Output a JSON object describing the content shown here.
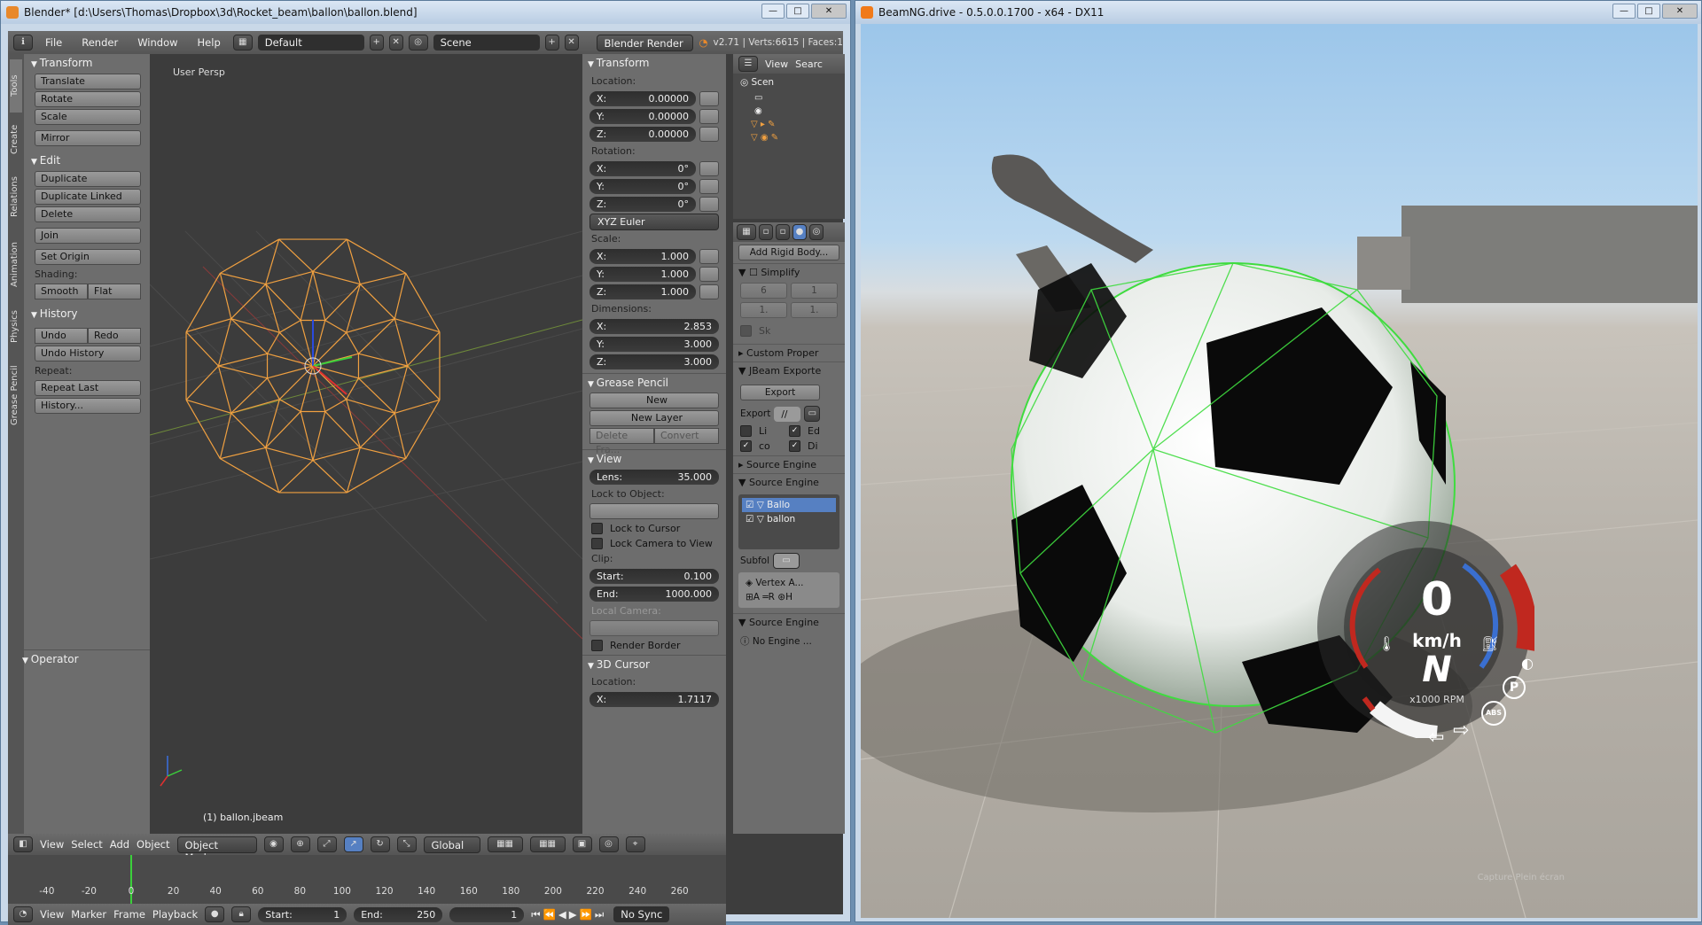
{
  "blender": {
    "title": "Blender* [d:\\Users\\Thomas\\Dropbox\\3d\\Rocket_beam\\ballon\\ballon.blend]",
    "menus": [
      "File",
      "Render",
      "Window",
      "Help"
    ],
    "layout": "Default",
    "scene": "Scene",
    "engine": "Blender Render",
    "stats": "v2.71 | Verts:6615 | Faces:1",
    "vtabs": [
      "Tools",
      "Create",
      "Relations",
      "Animation",
      "Physics",
      "Grease Pencil"
    ],
    "tools": {
      "transform_title": "Transform",
      "translate": "Translate",
      "rotate": "Rotate",
      "scale": "Scale",
      "mirror": "Mirror",
      "edit_title": "Edit",
      "duplicate": "Duplicate",
      "duplicate_linked": "Duplicate Linked",
      "delete": "Delete",
      "join": "Join",
      "set_origin": "Set Origin",
      "shading_label": "Shading:",
      "smooth": "Smooth",
      "flat": "Flat",
      "history_title": "History",
      "undo": "Undo",
      "redo": "Redo",
      "undo_history": "Undo History",
      "repeat_label": "Repeat:",
      "repeat_last": "Repeat Last",
      "history": "History...",
      "operator_title": "Operator"
    },
    "viewport": {
      "label": "User Persp",
      "object": "(1) ballon.jbeam"
    },
    "npanel": {
      "transform_title": "Transform",
      "location_label": "Location:",
      "loc": [
        [
          "X:",
          "0.00000"
        ],
        [
          "Y:",
          "0.00000"
        ],
        [
          "Z:",
          "0.00000"
        ]
      ],
      "rotation_label": "Rotation:",
      "rot": [
        [
          "X:",
          "0°"
        ],
        [
          "Y:",
          "0°"
        ],
        [
          "Z:",
          "0°"
        ]
      ],
      "rotation_mode": "XYZ Euler",
      "scale_label": "Scale:",
      "scale": [
        [
          "X:",
          "1.000"
        ],
        [
          "Y:",
          "1.000"
        ],
        [
          "Z:",
          "1.000"
        ]
      ],
      "dimensions_label": "Dimensions:",
      "dim": [
        [
          "X:",
          "2.853"
        ],
        [
          "Y:",
          "3.000"
        ],
        [
          "Z:",
          "3.000"
        ]
      ],
      "grease_title": "Grease Pencil",
      "new": "New",
      "new_layer": "New Layer",
      "delete_frame": "Delete Fra...",
      "convert": "Convert",
      "view_title": "View",
      "lens_label": "Lens:",
      "lens": "35.000",
      "lock_object_label": "Lock to Object:",
      "lock_cursor": "Lock to Cursor",
      "lock_camera": "Lock Camera to View",
      "clip_label": "Clip:",
      "clip_start_label": "Start:",
      "clip_start": "0.100",
      "clip_end_label": "End:",
      "clip_end": "1000.000",
      "local_camera_label": "Local Camera:",
      "render_border": "Render Border",
      "cursor_title": "3D Cursor",
      "cursor_location_label": "Location:",
      "cursor_x_label": "X:",
      "cursor_x": "1.7117"
    },
    "outliner": {
      "view": "View",
      "search": "Searc",
      "scene": "Scen"
    },
    "props": {
      "add_rigid": "Add Rigid Body...",
      "simplify": "Simplify",
      "custom_props": "Custom Proper",
      "jbeam_export": "JBeam Exporte",
      "export_btn": "Export",
      "export_label": "Export",
      "export_path": "//",
      "checks": [
        "Li",
        "Ed",
        "co",
        "Di"
      ],
      "source_engine_1": "Source Engine",
      "source_engine_2": "Source Engine",
      "list": [
        "Ballo",
        "ballon"
      ],
      "subfolder": "Subfol",
      "vertex_anim": "Vertex A...",
      "source_engine_3": "Source Engine",
      "no_engine": "No Engine ..."
    },
    "vpheader": {
      "view": "View",
      "select": "Select",
      "add": "Add",
      "object": "Object",
      "mode": "Object Mode",
      "orientation": "Global"
    },
    "timeline": {
      "ticks": [
        "-40",
        "-20",
        "0",
        "20",
        "40",
        "60",
        "80",
        "100",
        "120",
        "140",
        "160",
        "180",
        "200",
        "220",
        "240",
        "260"
      ],
      "view": "View",
      "marker": "Marker",
      "frame": "Frame",
      "playback": "Playback",
      "start_label": "Start:",
      "start": "1",
      "end_label": "End:",
      "end": "250",
      "current": "1",
      "sync": "No Sync"
    }
  },
  "beamng": {
    "title": "BeamNG.drive - 0.5.0.0.1700 - x64 - DX11",
    "speed": "0",
    "unit": "km/h",
    "gear": "N",
    "rpm_label": "x1000 RPM",
    "park": "P",
    "abs": "ABS",
    "credit": "Capture Plein écran"
  },
  "colors": {
    "blender_bg": "#3d3d3d",
    "wire": "#f0a040",
    "ball_wire": "#3fdc3f",
    "dash_red": "#c0281f",
    "dash_blue": "#3a6fd0"
  }
}
